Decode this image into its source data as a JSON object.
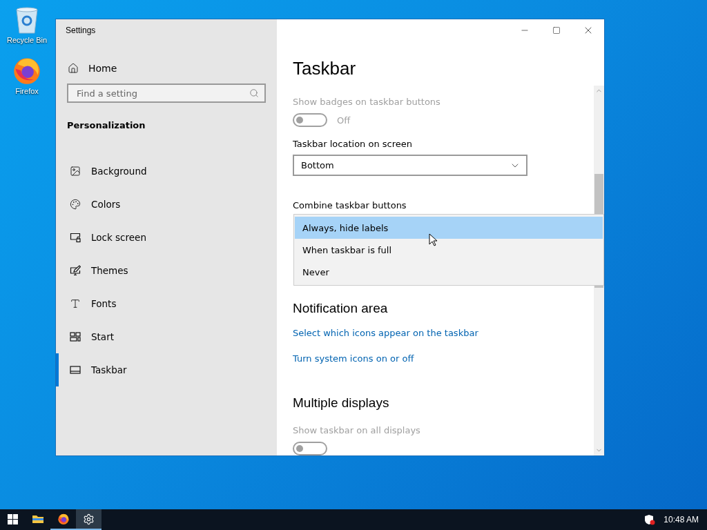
{
  "desktop_icons": [
    {
      "label": "Recycle Bin",
      "kind": "recycle"
    },
    {
      "label": "Firefox",
      "kind": "firefox"
    }
  ],
  "window": {
    "title": "Settings"
  },
  "sidebar": {
    "home": "Home",
    "search": {
      "placeholder": "Find a setting"
    },
    "section": "Personalization",
    "items": [
      {
        "label": "Background",
        "kind": "background",
        "selected": false
      },
      {
        "label": "Colors",
        "kind": "colors",
        "selected": false
      },
      {
        "label": "Lock screen",
        "kind": "lock",
        "selected": false
      },
      {
        "label": "Themes",
        "kind": "themes",
        "selected": false
      },
      {
        "label": "Fonts",
        "kind": "fonts",
        "selected": false
      },
      {
        "label": "Start",
        "kind": "start",
        "selected": false
      },
      {
        "label": "Taskbar",
        "kind": "taskbar",
        "selected": true
      }
    ]
  },
  "content": {
    "title": "Taskbar",
    "badges": {
      "label": "Show badges on taskbar buttons",
      "on": false,
      "state": "Off",
      "disabled": true
    },
    "location": {
      "label": "Taskbar location on screen",
      "value": "Bottom"
    },
    "combine": {
      "label": "Combine taskbar buttons",
      "options": [
        {
          "label": "Always, hide labels",
          "selected": true
        },
        {
          "label": "When taskbar is full",
          "selected": false
        },
        {
          "label": "Never",
          "selected": false
        }
      ]
    },
    "notification": {
      "heading": "Notification area",
      "links": [
        "Select which icons appear on the taskbar",
        "Turn system icons on or off"
      ]
    },
    "multiple": {
      "heading": "Multiple displays",
      "setting": {
        "label": "Show taskbar on all displays",
        "on": false,
        "disabled": true
      }
    }
  },
  "taskbar": {
    "apps": [
      {
        "kind": "explorer",
        "open": false,
        "selected": false
      },
      {
        "kind": "firefox",
        "open": true,
        "selected": false
      },
      {
        "kind": "settings",
        "open": true,
        "selected": true
      }
    ],
    "clock": "10:48 AM"
  }
}
